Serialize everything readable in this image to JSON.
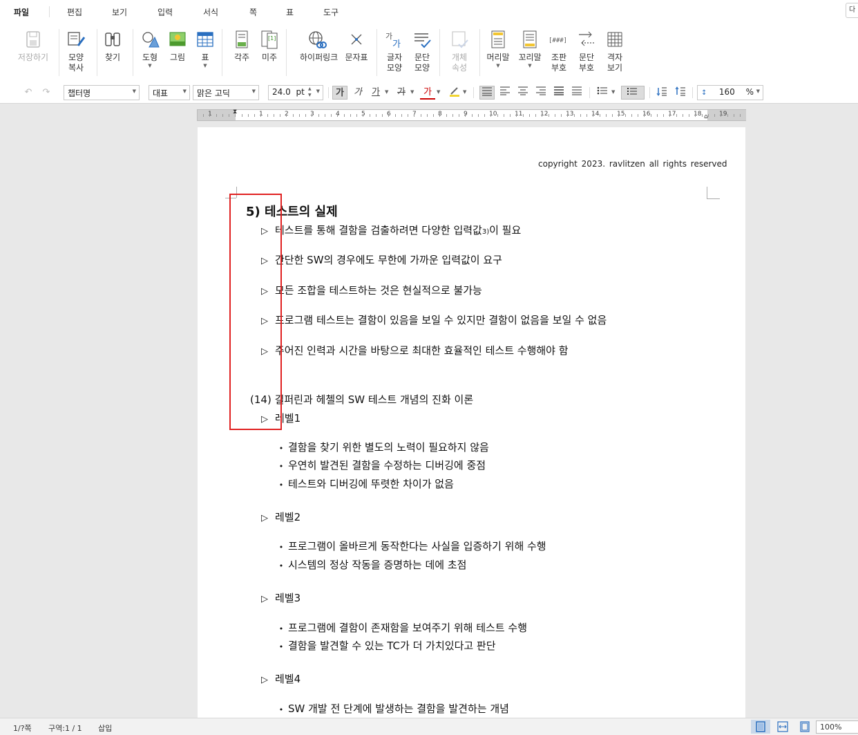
{
  "menu": {
    "items": [
      "파일",
      "편집",
      "보기",
      "입력",
      "서식",
      "쪽",
      "표",
      "도구"
    ],
    "corner": "다"
  },
  "ribbon": {
    "save": {
      "line1": "저장하기",
      "line2": ""
    },
    "format_copy": {
      "line1": "모양",
      "line2": "복사"
    },
    "find": {
      "line1": "찾기",
      "line2": ""
    },
    "shape": {
      "line1": "도형",
      "line2": ""
    },
    "picture": {
      "line1": "그림",
      "line2": ""
    },
    "table": {
      "line1": "표",
      "line2": ""
    },
    "footnote": {
      "line1": "각주",
      "line2": ""
    },
    "endnote": {
      "line1": "미주",
      "line2": ""
    },
    "hyperlink": {
      "line1": "하이퍼링크",
      "line2": ""
    },
    "symbol": {
      "line1": "문자표",
      "line2": ""
    },
    "char_shape": {
      "line1": "글자",
      "line2": "모양"
    },
    "para_shape": {
      "line1": "문단",
      "line2": "모양"
    },
    "object_props": {
      "line1": "개체",
      "line2": "속성"
    },
    "header": {
      "line1": "머리말",
      "line2": ""
    },
    "footer": {
      "line1": "꼬리말",
      "line2": ""
    },
    "layout_marks": {
      "line1": "조판",
      "line2": "부호"
    },
    "para_marks": {
      "line1": "문단",
      "line2": "부호"
    },
    "grid_view": {
      "line1": "격자",
      "line2": "보기"
    }
  },
  "format": {
    "style": "챕터명",
    "lang": "대표",
    "font": "맑은 고딕",
    "size": "24.0",
    "size_unit": "pt",
    "bold": "가",
    "italic": "가",
    "underline": "가",
    "strike": "가",
    "color": "가",
    "line_spacing": "160",
    "line_spacing_unit": "%"
  },
  "ruler": {
    "numbers": [
      "1",
      "1",
      "2",
      "3",
      "4",
      "5",
      "6",
      "7",
      "8",
      "9",
      "10",
      "11",
      "12",
      "13",
      "14",
      "15",
      "16",
      "17",
      "18",
      "19"
    ]
  },
  "document": {
    "copyright": "copyright 2023. ravlitzen all rights reserved",
    "heading": "5) 테스트의 실제",
    "items": [
      {
        "text": "테스트를 통해 결함을 검출하려면 다양한 입력값",
        "sup": "3)",
        "tail": "이 필요"
      },
      {
        "text": "간단한 SW의 경우에도 무한에 가까운 입력값이 요구",
        "sup": "",
        "tail": ""
      },
      {
        "text": "모든 조합을 테스트하는 것은 현실적으로 불가능",
        "sup": "",
        "tail": ""
      },
      {
        "text": "프로그램 테스트는 결함이 있음을 보일 수 있지만 결함이 없음을 보일 수 없음",
        "sup": "",
        "tail": ""
      },
      {
        "text": "주어진 인력과 시간을 바탕으로 최대한 효율적인 테스트 수행해야 함",
        "sup": "",
        "tail": ""
      }
    ],
    "subheading_num": "(14)",
    "subheading": "길퍼린과 헤첼의 SW 테스트 개념의 진화 이론",
    "tri": "▷",
    "bullet": "•",
    "levels": [
      {
        "label": "레벨1",
        "bullets": [
          "결함을 찾기 위한 별도의 노력이 필요하지 않음",
          "우연히 발견된 결함을 수정하는 디버깅에 중점",
          "테스트와 디버깅에 뚜렷한 차이가 없음"
        ]
      },
      {
        "label": "레벨2",
        "bullets": [
          "프로그램이 올바르게 동작한다는 사실을 입증하기 위해 수행",
          "시스템의 정상 작동을 증명하는 데에 초점"
        ]
      },
      {
        "label": "레벨3",
        "bullets": [
          "프로그램에 결함이 존재함을 보여주기 위해 테스트 수행",
          "결함을 발견할 수 있는 TC가 더 가치있다고 판단"
        ]
      },
      {
        "label": "레벨4",
        "bullets": [
          "SW 개발 전 단계에 발생하는 결함을 발견하는 개념"
        ]
      }
    ]
  },
  "status": {
    "page": "1/?쪽",
    "section": "구역:1 / 1",
    "mode": "삽입",
    "zoom": "100%"
  },
  "colors": {
    "highlight_box": "#e02020",
    "accent_icon": "#2a6fc0"
  }
}
